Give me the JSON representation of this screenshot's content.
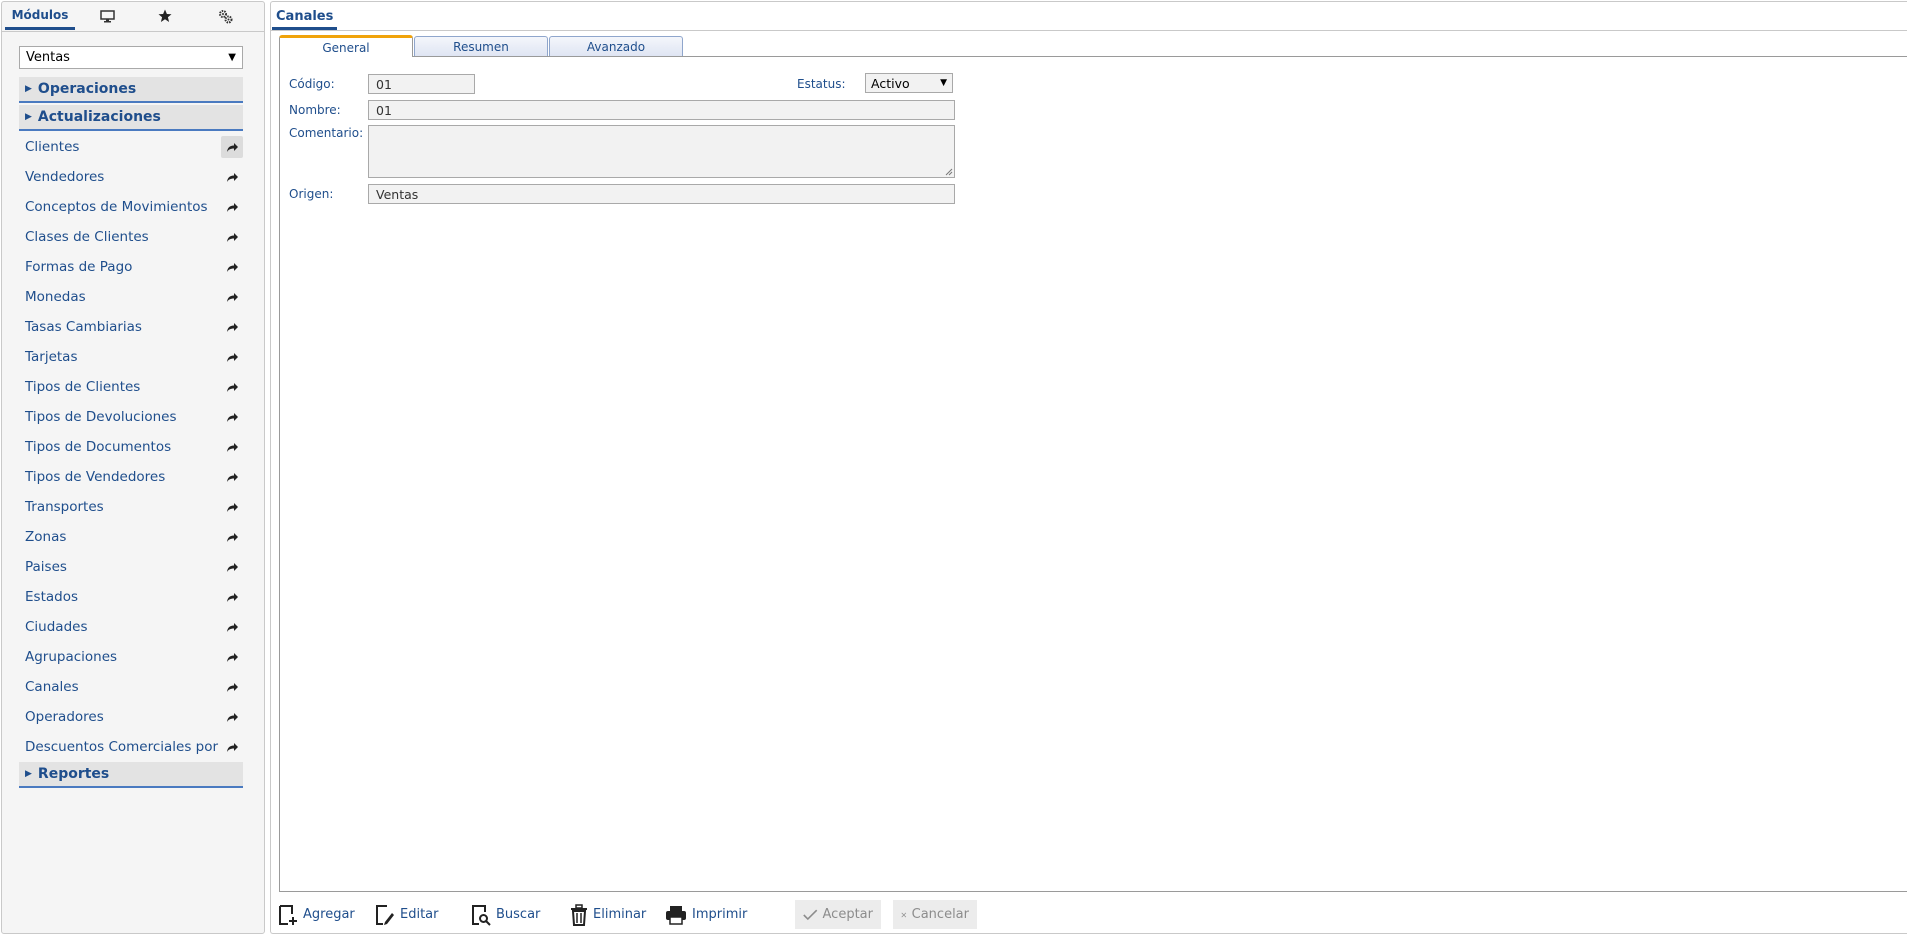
{
  "left_tabs": {
    "modulos_label": "Módulos",
    "icons": [
      "monitor-icon",
      "star-icon",
      "gears-icon"
    ]
  },
  "module_select": {
    "value": "Ventas"
  },
  "sections": {
    "operaciones": "Operaciones",
    "actualizaciones": "Actualizaciones",
    "reportes": "Reportes"
  },
  "nav_items": [
    "Clientes",
    "Vendedores",
    "Conceptos de Movimientos",
    "Clases de Clientes",
    "Formas de Pago",
    "Monedas",
    "Tasas Cambiarias",
    "Tarjetas",
    "Tipos de Clientes",
    "Tipos de Devoluciones",
    "Tipos de Documentos",
    "Tipos de Vendedores",
    "Transportes",
    "Zonas",
    "Paises",
    "Estados",
    "Ciudades",
    "Agrupaciones",
    "Canales",
    "Operadores",
    "Descuentos Comerciales por Vendedor"
  ],
  "window": {
    "title": "Canales"
  },
  "form_tabs": {
    "general": "General",
    "resumen": "Resumen",
    "avanzado": "Avanzado"
  },
  "form": {
    "codigo_label": "Código:",
    "codigo_value": "01",
    "estatus_label": "Estatus:",
    "estatus_value": "Activo",
    "nombre_label": "Nombre:",
    "nombre_value": "01",
    "comentario_label": "Comentario:",
    "comentario_value": "",
    "origen_label": "Origen:",
    "origen_value": "Ventas"
  },
  "toolbar": {
    "agregar": "Agregar",
    "editar": "Editar",
    "buscar": "Buscar",
    "eliminar": "Eliminar",
    "imprimir": "Imprimir",
    "aceptar": "Aceptar",
    "cancelar": "Cancelar"
  },
  "colors": {
    "accent": "#1f4e8c",
    "active_tab": "#f0a30a",
    "section_border": "#4a7ac0"
  }
}
